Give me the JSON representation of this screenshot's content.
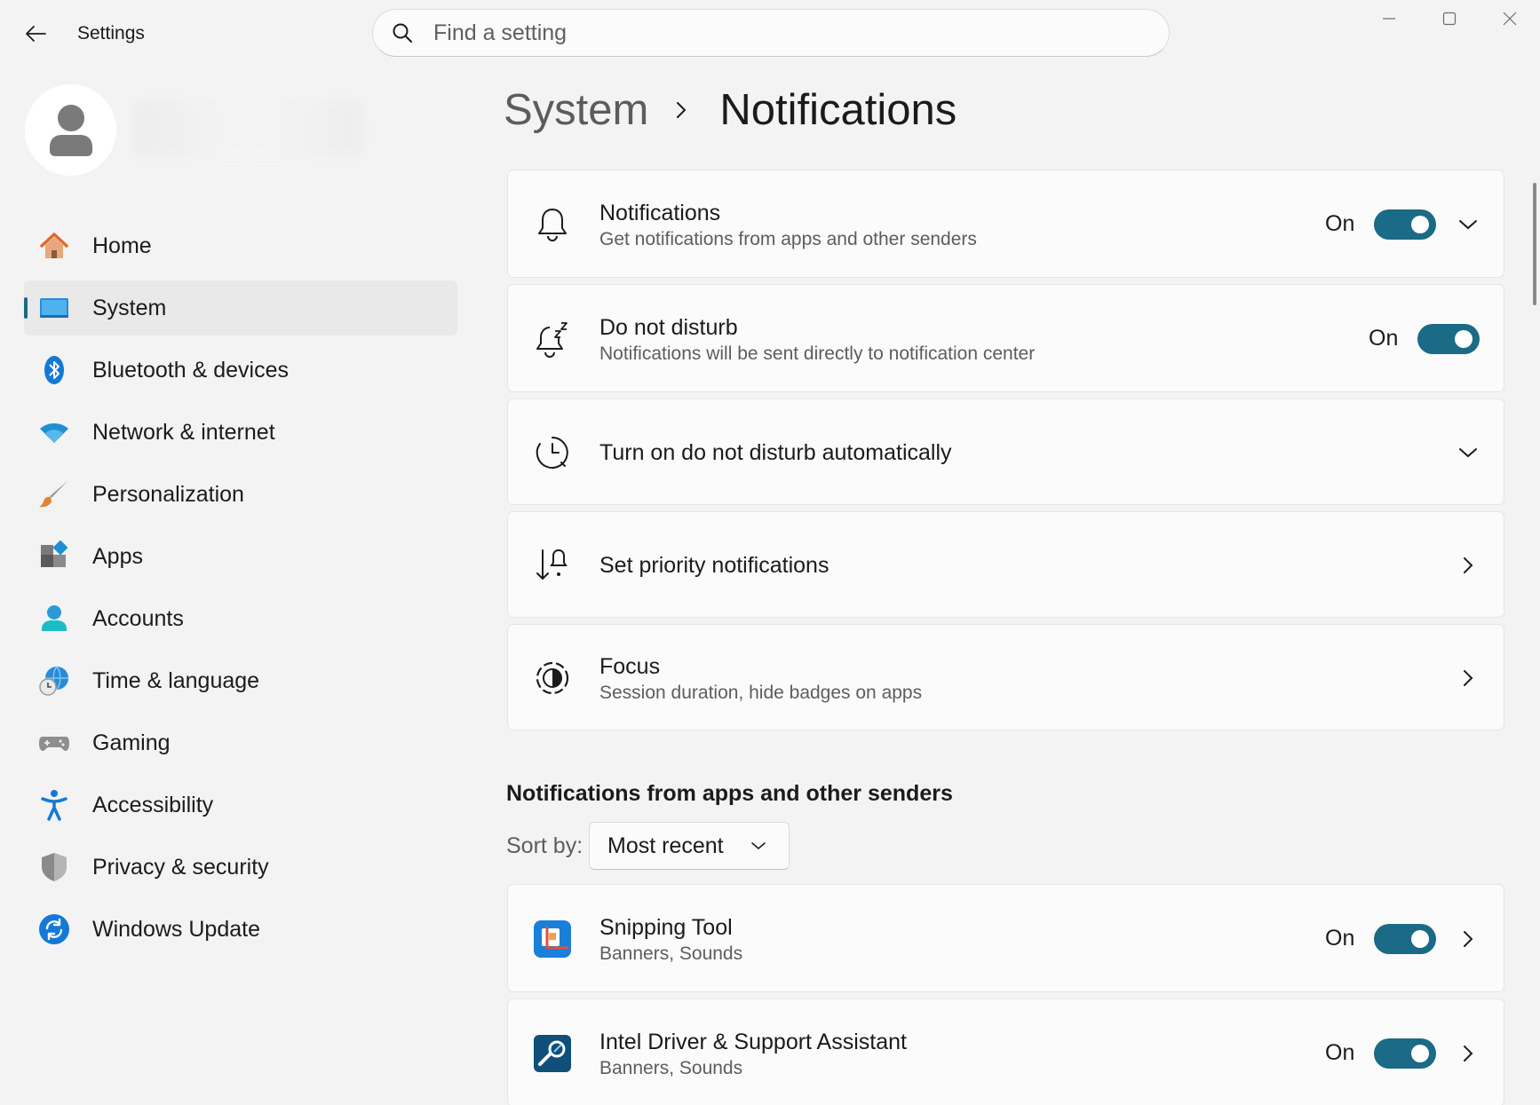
{
  "window": {
    "title": "Settings"
  },
  "search": {
    "placeholder": "Find a setting"
  },
  "sidebar": {
    "items": [
      {
        "label": "Home",
        "icon": "home-icon"
      },
      {
        "label": "System",
        "icon": "system-icon",
        "active": true
      },
      {
        "label": "Bluetooth & devices",
        "icon": "bluetooth-icon"
      },
      {
        "label": "Network & internet",
        "icon": "wifi-icon"
      },
      {
        "label": "Personalization",
        "icon": "brush-icon"
      },
      {
        "label": "Apps",
        "icon": "apps-icon"
      },
      {
        "label": "Accounts",
        "icon": "account-icon"
      },
      {
        "label": "Time & language",
        "icon": "globe-clock-icon"
      },
      {
        "label": "Gaming",
        "icon": "gamepad-icon"
      },
      {
        "label": "Accessibility",
        "icon": "accessibility-icon"
      },
      {
        "label": "Privacy & security",
        "icon": "shield-icon"
      },
      {
        "label": "Windows Update",
        "icon": "update-icon"
      }
    ]
  },
  "breadcrumb": {
    "parent": "System",
    "current": "Notifications"
  },
  "settings": {
    "notifications": {
      "title": "Notifications",
      "subtitle": "Get notifications from apps and other senders",
      "state": "On"
    },
    "dnd": {
      "title": "Do not disturb",
      "subtitle": "Notifications will be sent directly to notification center",
      "state": "On"
    },
    "dnd_auto": {
      "title": "Turn on do not disturb automatically"
    },
    "priority": {
      "title": "Set priority notifications"
    },
    "focus": {
      "title": "Focus",
      "subtitle": "Session duration, hide badges on apps"
    }
  },
  "apps_section": {
    "title": "Notifications from apps and other senders",
    "sort_label": "Sort by:",
    "sort_value": "Most recent",
    "apps": [
      {
        "name": "Snipping Tool",
        "detail": "Banners, Sounds",
        "state": "On"
      },
      {
        "name": "Intel Driver & Support Assistant",
        "detail": "Banners, Sounds",
        "state": "On"
      }
    ]
  },
  "colors": {
    "accent": "#1b6a86",
    "background": "#f3f3f3",
    "card": "#fbfbfb"
  }
}
